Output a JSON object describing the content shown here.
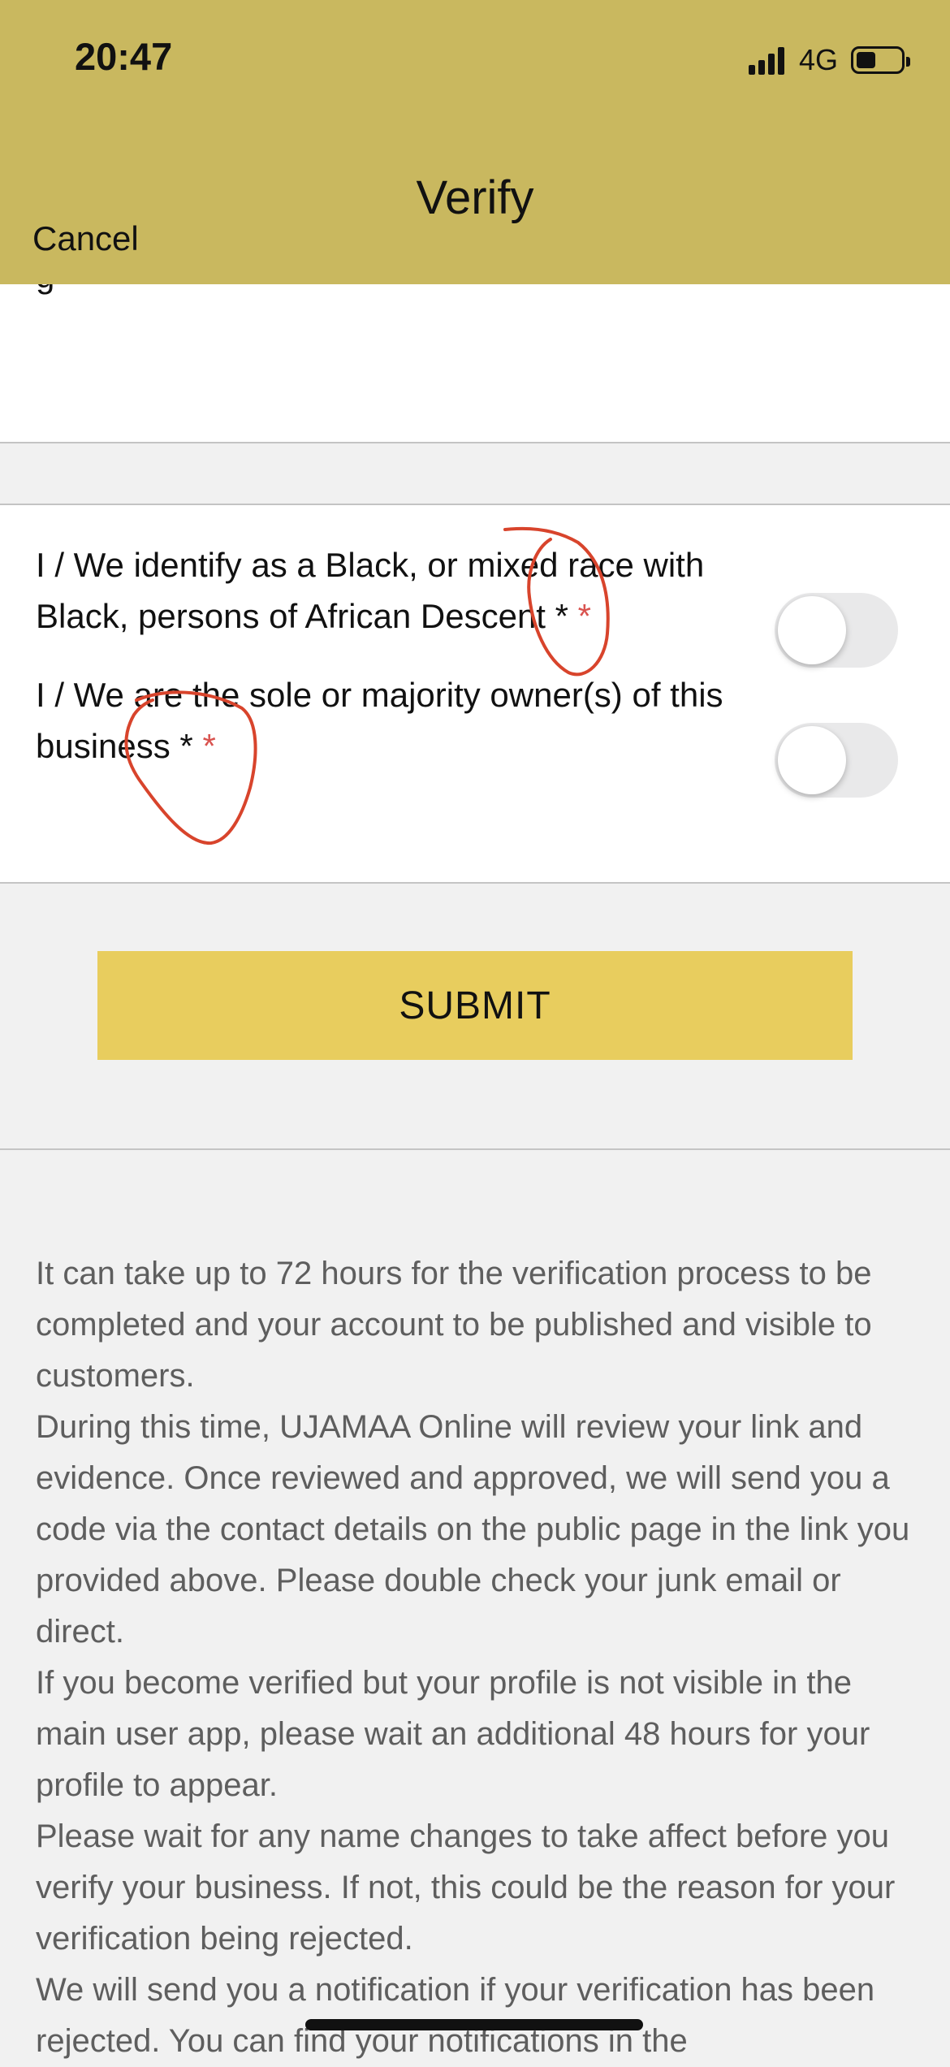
{
  "status_bar": {
    "time": "20:47",
    "network": "4G",
    "battery_level": 0.45
  },
  "nav": {
    "title": "Verify",
    "cancel_label": "Cancel",
    "background_color": "#c9b85f"
  },
  "toggles": [
    {
      "label": "I / We identify as a Black, or mixed race with Black, persons of African Descent *",
      "required_mark": "*",
      "checked": false
    },
    {
      "label": "I / We are the sole or majority owner(s) of this business *",
      "required_mark": "*",
      "checked": false
    }
  ],
  "submit_label": "SUBMIT",
  "submit_color": "#e8cd5e",
  "info_paragraphs": [
    "It can take up to 72 hours for the verification process to be completed and your account to be published and visible to customers.",
    "During this time, UJAMAA Online will review your link and evidence. Once reviewed and approved, we will send you a code via the contact details on the public page in the link you provided above. Please double check your junk email or direct.",
    "If you become verified but your profile is not visible in the main user app, please wait an additional 48 hours for your profile to appear.",
    "Please wait for any name changes to take affect before you verify your business. If not, this could be the reason for your verification being rejected.",
    "We will send you a notification if your verification has been rejected. You can find your notifications in the"
  ]
}
